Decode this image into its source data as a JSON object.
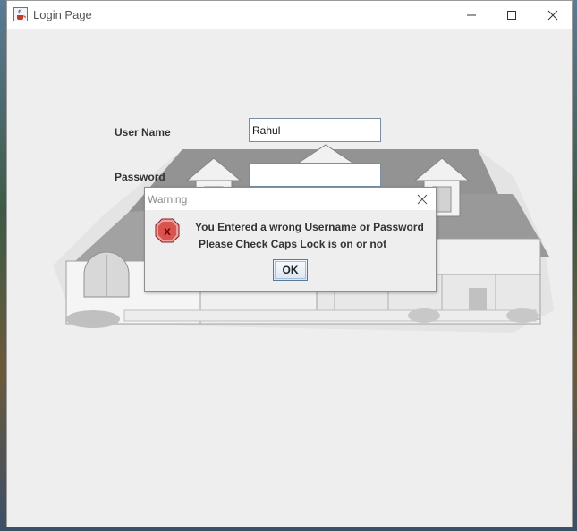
{
  "window": {
    "title": "Login Page",
    "icon": "java-cup-icon",
    "controls": [
      "minimize-icon",
      "maximize-icon",
      "close-icon"
    ]
  },
  "form": {
    "username_label": "User Name",
    "username_value": "Rahul",
    "password_label": "Password",
    "password_value": ""
  },
  "dialog": {
    "title": "Warning",
    "icon": "error-x-icon",
    "message_line1": "You Entered a wrong Username or Password",
    "message_line2": "Please Check Caps Lock is on or not",
    "ok_label": "OK"
  },
  "colors": {
    "error_icon_fill": "#d9534f",
    "error_icon_letter": "#7a0000",
    "ok_border": "#5b7a98"
  }
}
